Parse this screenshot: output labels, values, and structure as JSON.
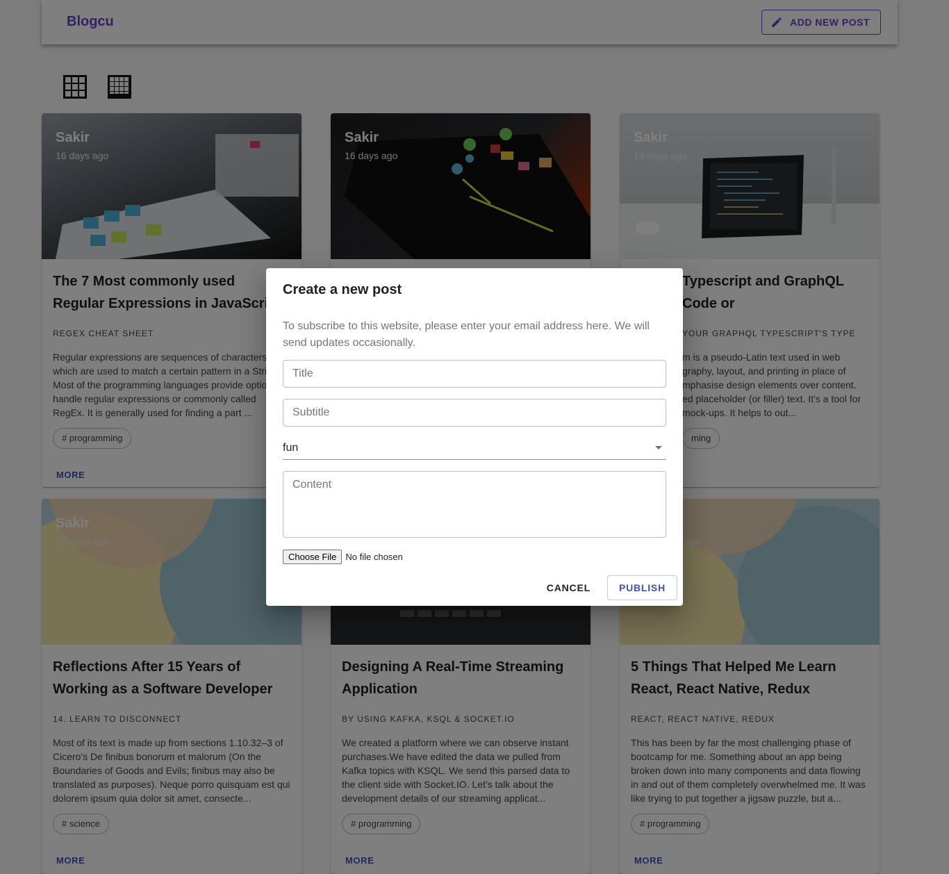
{
  "app": {
    "title": "Blogcu",
    "add_button": "ADD NEW POST",
    "add_icon": "pencil-icon"
  },
  "view_toggles": [
    {
      "icon": "grid-3x3-icon"
    },
    {
      "icon": "grid-4x4-icon"
    }
  ],
  "cards": [
    {
      "author": "Sakir",
      "date": "16 days ago",
      "title": "The 7 Most commonly used Regular Expressions in JavaScript",
      "subtitle": "Regex Cheat Sheet",
      "excerpt": "Regular expressions are sequences of characters which are used to match a certain pattern in a String. Most of the programming languages provide options to handle regular expressions or commonly called RegEx. It is generally used for finding a part ...",
      "tag": "# programming",
      "more": "MORE"
    },
    {
      "author": "Sakir",
      "date": "16 days ago",
      "title": "",
      "subtitle": "",
      "excerpt": "",
      "tag": "",
      "more": ""
    },
    {
      "author": "Sakir",
      "date": "16 days ago",
      "title": "Typescript and GraphQL Code or",
      "subtitle": "your GraphQL Typescript's type",
      "excerpt": "m is a pseudo-Latin text used in web graphy, layout, and printing in place of mphasise design elements over content. ed placeholder (or filler) text. It's a tool for mock-ups. It helps to out...",
      "tag": "ming",
      "more": ""
    },
    {
      "author": "Sakir",
      "date": "16 days ago",
      "title": "Reflections After 15 Years of Working as a Software Developer",
      "subtitle": "14. Learn to Disconnect",
      "excerpt": "Most of its text is made up from sections 1.10.32–3 of Cicero's De finibus bonorum et malorum (On the Boundaries of Goods and Evils; finibus may also be translated as purposes). Neque porro quisquam est qui dolorem ipsum quia dolor sit amet, consecte...",
      "tag": "# science",
      "more": "MORE"
    },
    {
      "author": "",
      "date": "",
      "title": "Designing A Real-Time Streaming Application",
      "subtitle": "By using Kafka, KSQL & Socket.IO",
      "excerpt": "We created a platform where we can observe instant purchases.We have edited the data we pulled from Kafka topics with KSQL. We send this parsed data to the client side with Socket.IO. Let's talk about the development details of our streaming applicat...",
      "tag": "# programming",
      "more": "MORE"
    },
    {
      "author": "",
      "date": "ago",
      "title": "5 Things That Helped Me Learn React, React Native, Redux",
      "subtitle": "React, React Native, Redux",
      "excerpt": "This has been by far the most challenging phase of bootcamp for me. Something about an app being broken down into many components and data flowing in and out of them completely overwhelmed me. It was like trying to put together a jigsaw puzzle, but a...",
      "tag": "# programming",
      "more": "MORE"
    }
  ],
  "dialog": {
    "title": "Create a new post",
    "text": "To subscribe to this website, please enter your email address here. We will send updates occasionally.",
    "title_placeholder": "Title",
    "subtitle_placeholder": "Subtitle",
    "category_value": "fun",
    "content_placeholder": "Content",
    "file_button": "Choose File",
    "file_status": "No file chosen",
    "cancel": "CANCEL",
    "publish": "PUBLISH"
  },
  "colors": {
    "brand": "#6a3fc1",
    "action": "#3f51b5"
  }
}
